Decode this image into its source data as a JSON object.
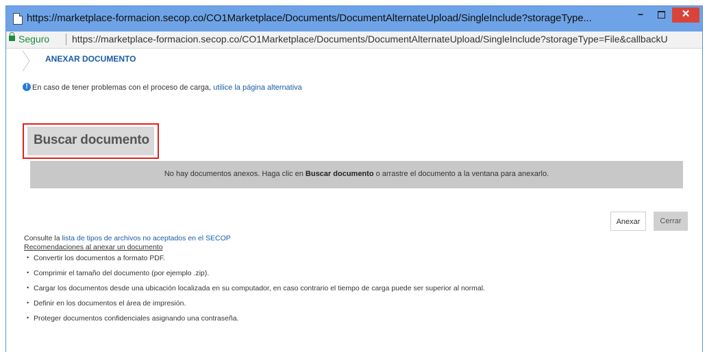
{
  "window": {
    "title": "https://marketplace-formacion.secop.co/CO1Marketplace/Documents/DocumentAlternateUpload/SingleInclude?storageType...",
    "minimize_glyph": "−",
    "close_glyph": "✕"
  },
  "address": {
    "secure_label": "Seguro",
    "url": "https://marketplace-formacion.secop.co/CO1Marketplace/Documents/DocumentAlternateUpload/SingleInclude?storageType=File&callbackU"
  },
  "page": {
    "heading": "ANEXAR DOCUMENTO",
    "info_icon_glyph": "!",
    "info_text": "En caso de tener problemas con el proceso de carga, ",
    "info_link": "utilice la página alternativa",
    "search_button": "Buscar documento",
    "drop_zone": {
      "text_before": "No hay documentos anexos. Haga clic en ",
      "text_bold": "Buscar documento",
      "text_after": " o arrastre el documento a la ventana para anexarlo."
    },
    "attach_button": "Anexar",
    "close_button": "Cerrar",
    "consult_text": "Consulte la ",
    "consult_link": "lista de tipos de archivos no aceptados en el SECOP",
    "recommendations_title": "Recomendaciones al anexar un documento",
    "recommendations": [
      "Convertir los documentos a formato PDF.",
      "Comprimir el tamaño del documento (por ejemplo .zip).",
      "Cargar los documentos desde una ubicación localizada en su computador, en caso contrario el tiempo de carga puede ser superior al normal.",
      "Definir en los documentos el área de impresión.",
      "Proteger documentos confidenciales asignando una contraseña."
    ]
  },
  "colors": {
    "titlebar": "#6ea3e7",
    "close": "#d9443a",
    "link": "#1a5ba6",
    "highlight_border": "#e0201c",
    "secure": "#1f8a3b"
  }
}
